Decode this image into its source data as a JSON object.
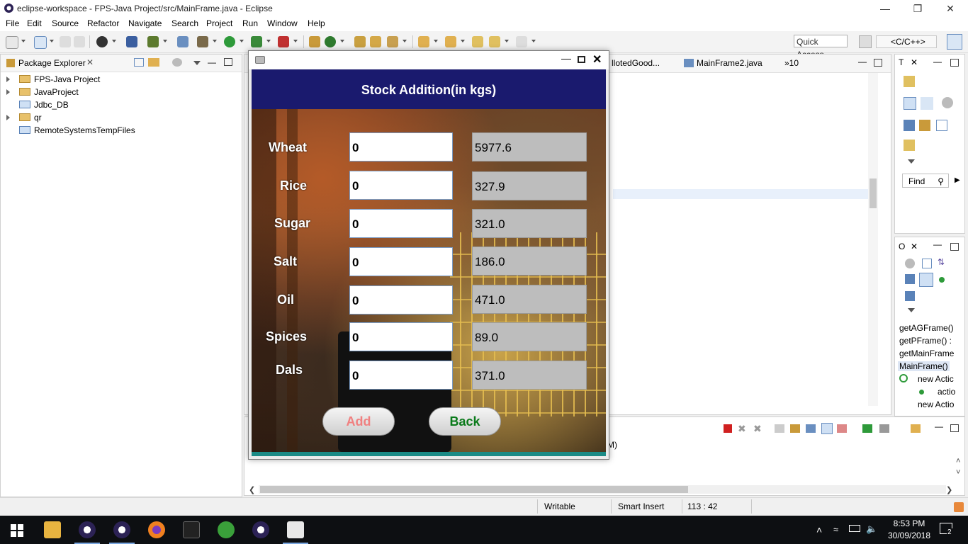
{
  "window": {
    "title": "eclipse-workspace - FPS-Java Project/src/MainFrame.java - Eclipse"
  },
  "menu": [
    "File",
    "Edit",
    "Source",
    "Refactor",
    "Navigate",
    "Search",
    "Project",
    "Run",
    "Window",
    "Help"
  ],
  "toolbar": {
    "quick_access": "Quick Access",
    "perspective": "<C/C++>"
  },
  "package_explorer": {
    "title": "Package Explorer",
    "items": [
      {
        "label": "FPS-Java Project",
        "expandable": true
      },
      {
        "label": "JavaProject",
        "expandable": true
      },
      {
        "label": "Jdbc_DB",
        "expandable": false
      },
      {
        "label": "qr",
        "expandable": true
      },
      {
        "label": "RemoteSystemsTempFiles",
        "expandable": false
      }
    ]
  },
  "editor": {
    "tabs": [
      {
        "label": "llotedGood..."
      },
      {
        "label": "MainFrame2.java"
      },
      {
        "label": "»10"
      }
    ]
  },
  "console": {
    "text": "M)"
  },
  "type_panel": {
    "title": "T",
    "find": "Find"
  },
  "outline": {
    "title": "O",
    "items": [
      "getAGFrame()",
      "getPFrame() : ",
      "getMainFrame",
      "MainFrame()",
      "new Actic",
      "actio",
      "new Actio"
    ]
  },
  "status": {
    "writable": "Writable",
    "insert": "Smart Insert",
    "position": "113 : 42"
  },
  "taskbar": {
    "time": "8:53 PM",
    "date": "30/09/2018",
    "notifications": "2"
  },
  "dialog": {
    "header": "Stock Addition(in kgs)",
    "rows": [
      {
        "label": "Wheat",
        "input": "0",
        "stock": "5977.6"
      },
      {
        "label": "Rice",
        "input": "0",
        "stock": "327.9"
      },
      {
        "label": "Sugar",
        "input": "0",
        "stock": "321.0"
      },
      {
        "label": "Salt",
        "input": "0",
        "stock": "186.0"
      },
      {
        "label": "Oil",
        "input": "0",
        "stock": "471.0"
      },
      {
        "label": "Spices",
        "input": "0",
        "stock": "89.0"
      },
      {
        "label": "Dals",
        "input": "0",
        "stock": "371.0"
      }
    ],
    "add_label": "Add",
    "back_label": "Back",
    "colors": {
      "header_bg": "#1a1a6e",
      "add_text": "#f08080",
      "back_text": "#0a7a1a"
    }
  }
}
